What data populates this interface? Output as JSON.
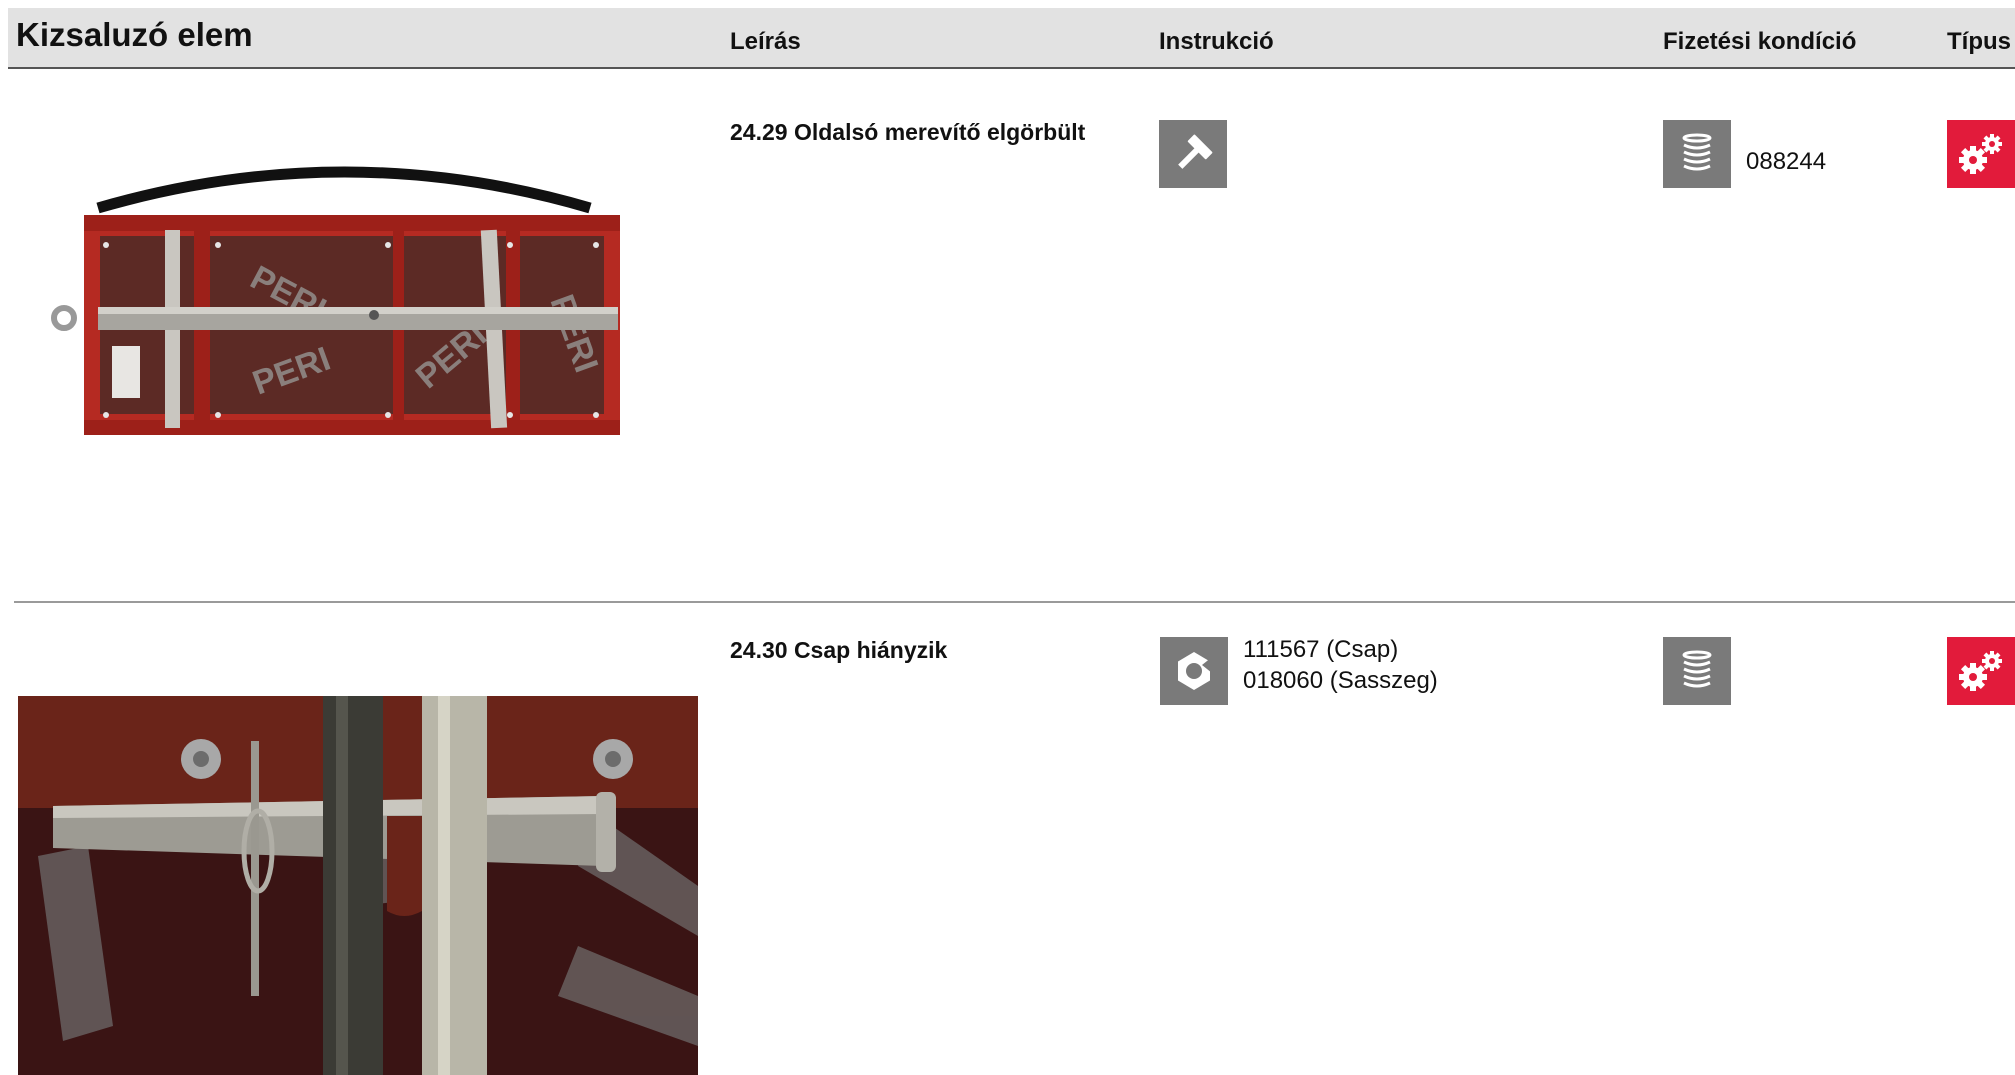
{
  "header": {
    "title": "Kizsaluzó elem",
    "col_description": "Leírás",
    "col_instruction": "Instrukció",
    "col_payment": "Fizetési kondíció",
    "col_type": "Típus"
  },
  "rows": [
    {
      "description": "24.29 Oldalsó merevítő elgörbült",
      "instruction_icon": "hammer-icon",
      "instruction_lines": [],
      "payment_icon": "coin-stack-icon",
      "payment_value": "088244",
      "type_icon": "gears-icon",
      "type_color": "#e21b3b"
    },
    {
      "description": "24.30 Csap hiányzik",
      "instruction_icon": "nut-icon",
      "instruction_lines": [
        "111567 (Csap)",
        "018060 (Sasszeg)"
      ],
      "payment_icon": "coin-stack-icon",
      "payment_value": "",
      "type_icon": "gears-icon",
      "type_color": "#e21b3b"
    }
  ],
  "photos": {
    "panel_stamp": "PERI"
  },
  "colors": {
    "header_bg": "#e2e2e2",
    "icon_tile": "#7a7a7a",
    "type_tile": "#e21b3b",
    "frame_red": "#b52a22"
  }
}
